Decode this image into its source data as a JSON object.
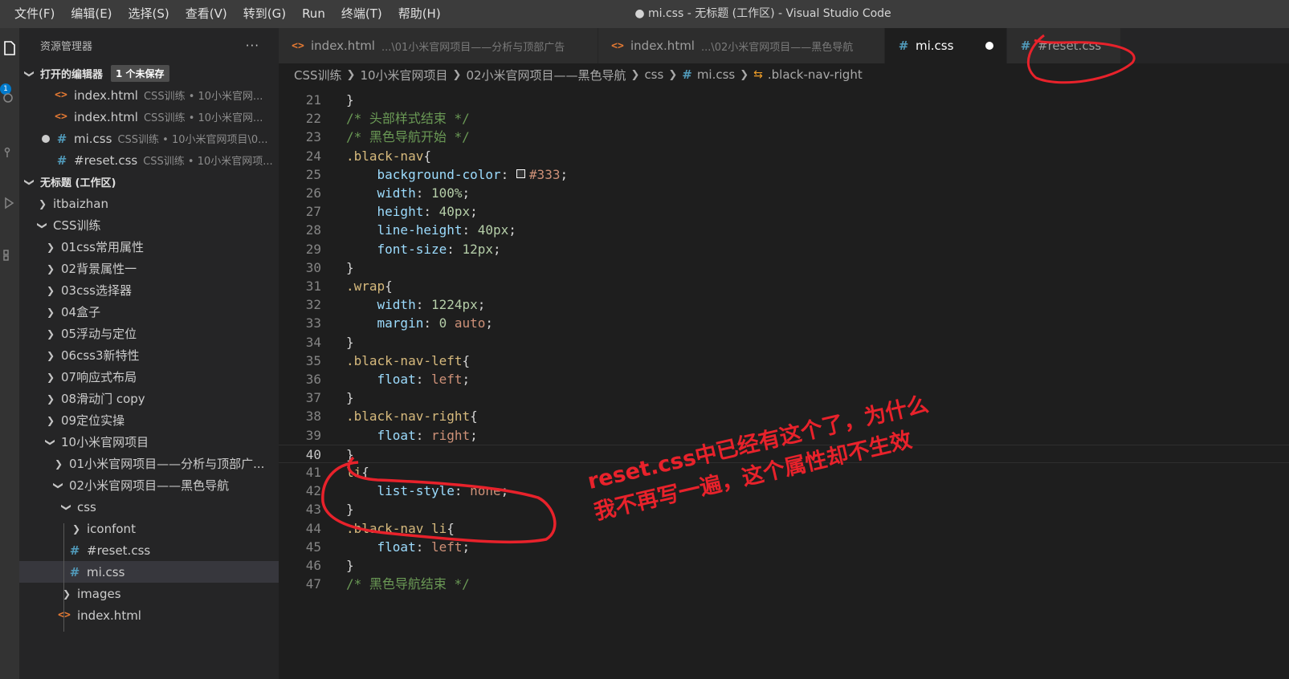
{
  "titlebar": {
    "menu": [
      "文件(F)",
      "编辑(E)",
      "选择(S)",
      "查看(V)",
      "转到(G)",
      "Run",
      "终端(T)",
      "帮助(H)"
    ],
    "title": "● mi.css - 无标题 (工作区) - Visual Studio Code"
  },
  "activity": {
    "badge": "1"
  },
  "sidebar": {
    "header": "资源管理器",
    "more": "···",
    "open_editors": {
      "label": "打开的编辑器",
      "badge": "1 个未保存",
      "items": [
        {
          "name": "index.html",
          "desc": "CSS训练 • 10小米官网..."
        },
        {
          "name": "index.html",
          "desc": "CSS训练 • 10小米官网..."
        },
        {
          "name": "mi.css",
          "desc": "CSS训练 • 10小米官网项目\\0..."
        },
        {
          "name": "#reset.css",
          "desc": "CSS训练 • 10小米官网项..."
        }
      ]
    },
    "workspace": {
      "label": "无标题 (工作区)",
      "itbaizhan": "itbaizhan",
      "css_root": "CSS训练",
      "folders": [
        "01css常用属性",
        "02背景属性一",
        "03css选择器",
        "04盒子",
        "05浮动与定位",
        "06css3新特性",
        "07响应式布局",
        "08滑动门 copy",
        "09定位实操",
        "10小米官网项目"
      ],
      "sub_01": "01小米官网项目——分析与顶部广...",
      "sub_02": "02小米官网项目——黑色导航",
      "css_folder": "css",
      "iconfont": "iconfont",
      "reset_css": "#reset.css",
      "mi_css": "mi.css",
      "images": "images",
      "index_html": "index.html"
    }
  },
  "tabs": [
    {
      "name": "index.html",
      "desc": "...\\01小米官网项目——分析与顶部广告"
    },
    {
      "name": "index.html",
      "desc": "...\\02小米官网项目——黑色导航"
    },
    {
      "name": "mi.css",
      "desc": ""
    },
    {
      "name": "#reset.css",
      "desc": ""
    }
  ],
  "breadcrumb": [
    "CSS训练",
    "10小米官网项目",
    "02小米官网项目——黑色导航",
    "css",
    "mi.css",
    ".black-nav-right"
  ],
  "editor": {
    "current_line": 40,
    "lines": [
      {
        "n": "21",
        "code": "}"
      },
      {
        "n": "22",
        "code": "/* 头部样式结束 */"
      },
      {
        "n": "23",
        "code": "/* 黑色导航开始 */"
      },
      {
        "n": "24",
        "code": ".black-nav{"
      },
      {
        "n": "25",
        "code": "    background-color: #333;"
      },
      {
        "n": "26",
        "code": "    width: 100%;"
      },
      {
        "n": "27",
        "code": "    height: 40px;"
      },
      {
        "n": "28",
        "code": "    line-height: 40px;"
      },
      {
        "n": "29",
        "code": "    font-size: 12px;"
      },
      {
        "n": "30",
        "code": "}"
      },
      {
        "n": "31",
        "code": ".wrap{"
      },
      {
        "n": "32",
        "code": "    width: 1224px;"
      },
      {
        "n": "33",
        "code": "    margin: 0 auto;"
      },
      {
        "n": "34",
        "code": "}"
      },
      {
        "n": "35",
        "code": ".black-nav-left{"
      },
      {
        "n": "36",
        "code": "    float: left;"
      },
      {
        "n": "37",
        "code": "}"
      },
      {
        "n": "38",
        "code": ".black-nav-right{"
      },
      {
        "n": "39",
        "code": "    float: right;"
      },
      {
        "n": "40",
        "code": "}"
      },
      {
        "n": "41",
        "code": "li{"
      },
      {
        "n": "42",
        "code": "    list-style: none;"
      },
      {
        "n": "43",
        "code": "}"
      },
      {
        "n": "44",
        "code": ".black-nav li{"
      },
      {
        "n": "45",
        "code": "    float: left;"
      },
      {
        "n": "46",
        "code": "}"
      },
      {
        "n": "47",
        "code": "/* 黑色导航结束 */"
      }
    ]
  },
  "annotation": {
    "line1": "reset.css中已经有这个了，为什么",
    "line2": "我不再写一遍，这个属性却不生效",
    "color": "#e8222b"
  }
}
